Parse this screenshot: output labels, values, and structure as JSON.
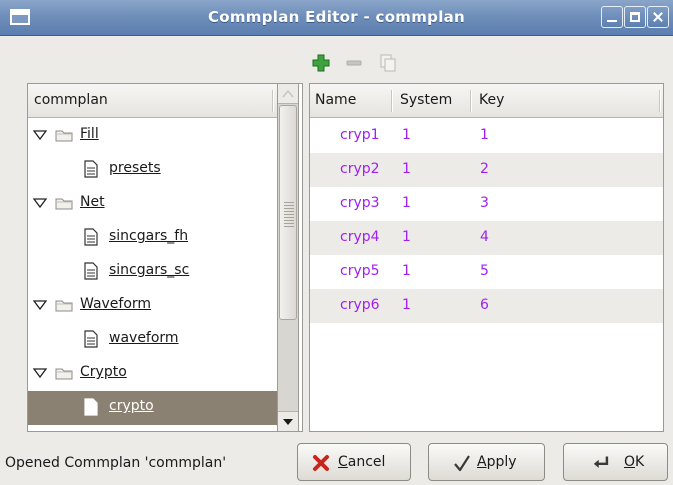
{
  "window": {
    "title": "Commplan Editor - commplan"
  },
  "toolbar": {
    "add_icon": "add-icon",
    "remove_icon": "remove-icon",
    "copy_icon": "copy-icon"
  },
  "tree": {
    "header": "commplan",
    "nodes": [
      {
        "label": "Fill",
        "kind": "folder",
        "expanded": true
      },
      {
        "label": "presets",
        "kind": "document"
      },
      {
        "label": "Net",
        "kind": "folder",
        "expanded": true
      },
      {
        "label": "sincgars_fh",
        "kind": "document"
      },
      {
        "label": "sincgars_sc",
        "kind": "document"
      },
      {
        "label": "Waveform",
        "kind": "folder",
        "expanded": true
      },
      {
        "label": "waveform",
        "kind": "document"
      },
      {
        "label": "Crypto",
        "kind": "folder",
        "expanded": true
      },
      {
        "label": "crypto",
        "kind": "document",
        "selected": true
      }
    ]
  },
  "key_table": {
    "columns": [
      "Name",
      "System",
      "Key"
    ],
    "rows": [
      {
        "name": "cryp1",
        "system": "1",
        "key": "1"
      },
      {
        "name": "cryp2",
        "system": "1",
        "key": "2"
      },
      {
        "name": "cryp3",
        "system": "1",
        "key": "3"
      },
      {
        "name": "cryp4",
        "system": "1",
        "key": "4"
      },
      {
        "name": "cryp5",
        "system": "1",
        "key": "5"
      },
      {
        "name": "cryp6",
        "system": "1",
        "key": "6"
      }
    ],
    "value_color": "#a020f0"
  },
  "status": {
    "text": "Opened Commplan 'commplan'"
  },
  "buttons": {
    "cancel": "Cancel",
    "apply": "Apply",
    "ok": "OK"
  },
  "colors": {
    "titlebar": "#6f8fba",
    "selection": "#8b8172"
  }
}
